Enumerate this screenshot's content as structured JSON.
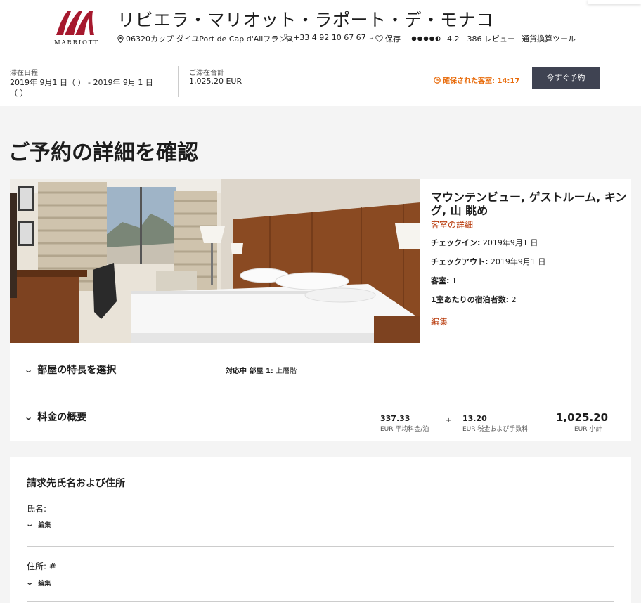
{
  "header": {
    "brand": "MARRIOTT",
    "hotel_name": "リビエラ・マリオット・ラポート・デ・モナコ",
    "address": "06320カップ ダイユPort de Cap d'Ailフランス",
    "phone": "+33 4 92 10 67 67",
    "save_label": "保存",
    "rating": "4.2",
    "reviews": "386 レビュー",
    "currency_tool": "通貨換算ツール",
    "icons": [
      "location-pin-icon",
      "phone-icon",
      "chevron-down-icon",
      "heart-icon",
      "rating-dots-icon"
    ],
    "brand_color": "#a6192e"
  },
  "stay": {
    "dates_label": "滞在日程",
    "dates_value_line1": "2019年 9月1 日（ ） - 2019年 9月 1 日",
    "dates_value_line2": "（ ）",
    "total_label": "ご滞在合計",
    "total_value": "1,025.20 EUR",
    "countdown_text": "確保された客室: 14:17",
    "book_now": "今すぐ予約",
    "countdown_color": "#e86b0b"
  },
  "page_title": "ご予約の詳細を確認",
  "room": {
    "name": "マウンテンビュー, ゲストルーム, キング, 山 眺め",
    "details_link": "客室の詳細",
    "checkin_label": "チェックイン:",
    "checkin_value": "2019年9月1 日",
    "checkout_label": "チェックアウト:",
    "checkout_value": "2019年9月1 日",
    "rooms_label": "客室:",
    "rooms_value": "1",
    "guests_label": "1室あたりの宿泊者数:",
    "guests_value": "2",
    "edit_link": "編集"
  },
  "features": {
    "heading": "部屋の特長を選択",
    "status_prefix": "対応中 部屋 1:",
    "status_value": "上層階"
  },
  "pricing": {
    "heading": "料金の概要",
    "avg_rate": "337.33",
    "avg_rate_label": "EUR 平均料金/泊",
    "plus": "+",
    "tax": "13.20",
    "tax_label": "EUR 税金および手数料",
    "subtotal": "1,025.20",
    "subtotal_label": "EUR 小計"
  },
  "billing": {
    "heading": "請求先氏名および住所",
    "name_label": "氏名:",
    "name_edit": "編集",
    "address_label": "住所: #",
    "address_edit": "編集"
  }
}
